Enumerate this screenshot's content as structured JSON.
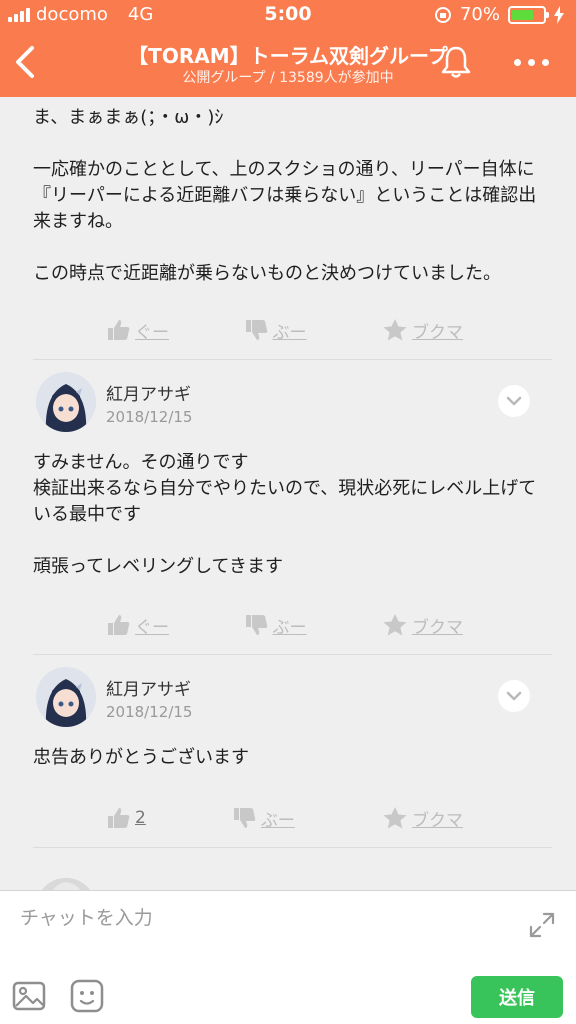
{
  "status_bar": {
    "carrier": "docomo",
    "network": "4G",
    "time": "5:00",
    "battery": "70%",
    "battery_level": 0.7
  },
  "header": {
    "title": "【TORAM】トーラム双剣グループ",
    "subtitle": "公開グループ / 13589人が参加中"
  },
  "posts": [
    {
      "text": "ま、まぁまぁ(；・ω・)ｼ\n\n一応確かのこととして、上のスクショの通り、リーパー自体に『リーパーによる近距離バフは乗らない』ということは確認出来ますね。\n\nこの時点で近距離が乗らないものと決めつけていました。",
      "actions": {
        "good": "ぐー",
        "bad": "ぶー",
        "bookmark": "ブクマ"
      }
    },
    {
      "author": "紅月アサギ",
      "date": "2018/12/15",
      "text": "すみません。その通りです\n検証出来るなら自分でやりたいので、現状必死にレベル上げている最中です\n\n頑張ってレベリングしてきます",
      "actions": {
        "good": "ぐー",
        "bad": "ぶー",
        "bookmark": "ブクマ"
      }
    },
    {
      "author": "紅月アサギ",
      "date": "2018/12/15",
      "text": "忠告ありがとうございます",
      "actions": {
        "good": "2",
        "bad": "ぶー",
        "bookmark": "ブクマ"
      }
    }
  ],
  "input": {
    "placeholder": "チャットを入力",
    "value": ""
  },
  "send_label": "送信",
  "colors": {
    "header": "#fa7c4e",
    "send": "#38c45a",
    "battery": "#5ddc3c"
  }
}
